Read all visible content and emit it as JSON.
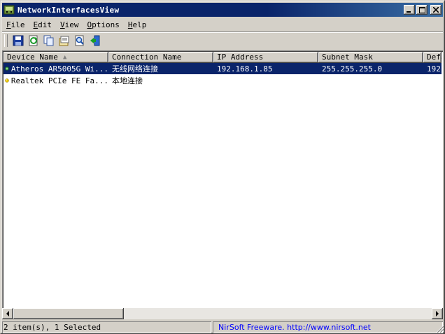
{
  "window": {
    "title": "NetworkInterfacesView"
  },
  "menu": [
    {
      "first": "F",
      "rest": "ile"
    },
    {
      "first": "E",
      "rest": "dit"
    },
    {
      "first": "V",
      "rest": "iew"
    },
    {
      "first": "O",
      "rest": "ptions"
    },
    {
      "first": "H",
      "rest": "elp"
    }
  ],
  "toolbar": {
    "icons": [
      "save-icon",
      "refresh-icon",
      "copy-icon",
      "properties-icon",
      "find-icon",
      "exit-icon"
    ]
  },
  "list": {
    "columns": [
      "Device Name",
      "Connection Name",
      "IP Address",
      "Subnet Mask",
      "Defa"
    ],
    "sort_indicator": "▲",
    "rows": [
      {
        "device": "Atheros AR5005G Wi...",
        "connection": "无线网络连接",
        "ip": "192.168.1.85",
        "mask": "255.255.255.0",
        "gateway": "192.",
        "status": "connected",
        "selected": true
      },
      {
        "device": "Realtek PCIe FE Fa...",
        "connection": "本地连接",
        "ip": "",
        "mask": "",
        "gateway": "",
        "status": "disconnected",
        "selected": false
      }
    ]
  },
  "status": {
    "items": "2 item(s), 1 Selected",
    "link": "NirSoft Freeware.  http://www.nirsoft.net"
  },
  "colors": {
    "title_bar": "#0a246a",
    "selection": "#0a246a",
    "link": "#0000ff",
    "face": "#d4d0c8"
  }
}
